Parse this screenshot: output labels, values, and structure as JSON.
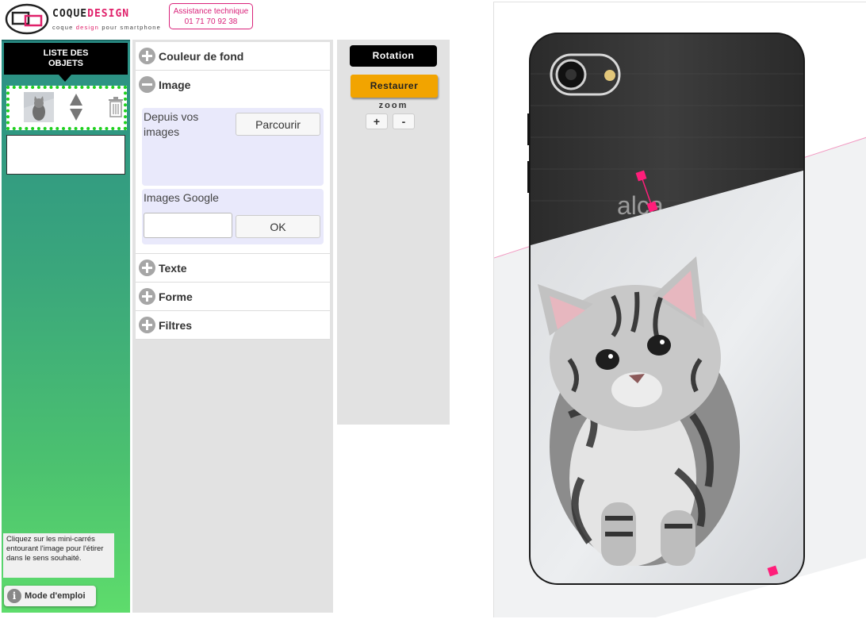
{
  "header": {
    "brand_prefix": "COQUE",
    "brand_suffix": "DESIGN",
    "tagline_a": "coque ",
    "tagline_b": "design",
    "tagline_c": " pour smartphone",
    "support_title": "Assistance technique",
    "support_phone": "01 71 70 92 38"
  },
  "sidebar": {
    "list_title_line1": "LISTE DES",
    "list_title_line2": "OBJETS",
    "help_text": "Cliquez sur les mini-carrés entourant l'image pour l'étirer dans le sens souhaité.",
    "manual_icon": "i",
    "manual_label": "Mode d'emploi"
  },
  "panel": {
    "sections": {
      "background": "Couleur de fond",
      "image": "Image",
      "text": "Texte",
      "shape": "Forme",
      "filters": "Filtres"
    },
    "image": {
      "from_images_line1": "Depuis vos",
      "from_images_line2": "images",
      "browse_button": "Parcourir",
      "google_label": "Images Google",
      "google_input_value": "",
      "ok_button": "OK"
    }
  },
  "controls": {
    "rotation": "Rotation",
    "restore": "Restaurer",
    "zoom_label": "zoom",
    "zoom_in": "+",
    "zoom_out": "-"
  },
  "canvas": {
    "phone_brand_text": "alca"
  },
  "colors": {
    "accent": "#e0206a",
    "restore": "#f2a400",
    "selection": "#1ed11e",
    "handle": "#ff1e7a"
  }
}
